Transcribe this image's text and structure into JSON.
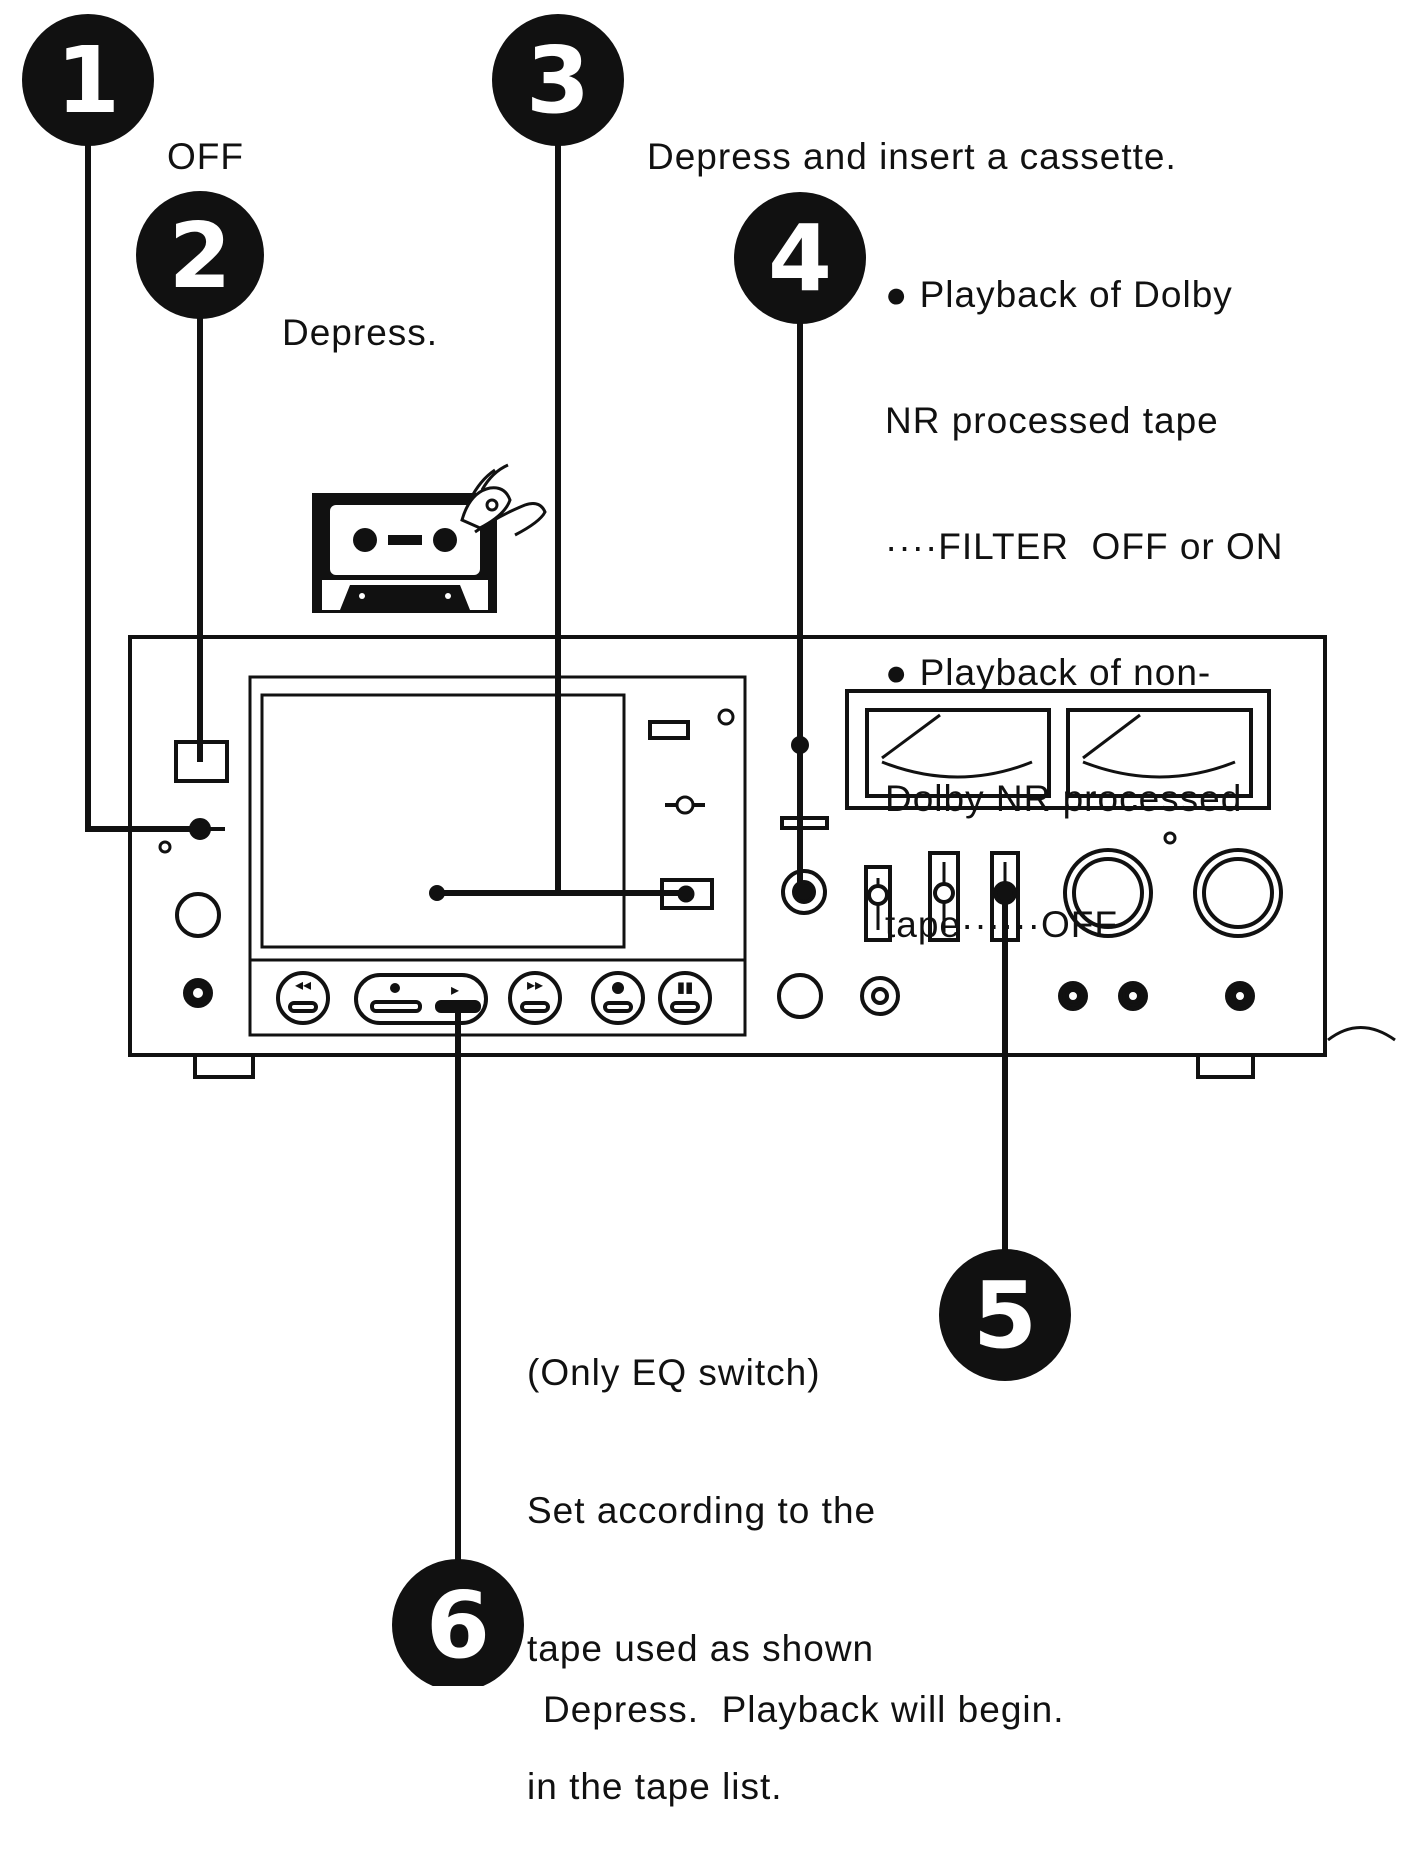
{
  "steps": [
    {
      "number": "1",
      "lines": [
        "OFF"
      ]
    },
    {
      "number": "2",
      "lines": [
        "Depress."
      ]
    },
    {
      "number": "3",
      "lines": [
        "Depress and insert a cassette."
      ]
    },
    {
      "number": "4",
      "lines": [
        "● Playback of Dolby",
        "NR processed tape",
        "····FILTER  OFF or ON",
        "● Playback of non-",
        "Dolby NR processed",
        "tape······OFF"
      ]
    },
    {
      "number": "5",
      "lines": [
        "(Only EQ switch)",
        "Set according to the",
        "tape used as shown",
        "in the tape list."
      ]
    },
    {
      "number": "6",
      "lines": [
        "Depress.  Playback will begin."
      ]
    }
  ]
}
